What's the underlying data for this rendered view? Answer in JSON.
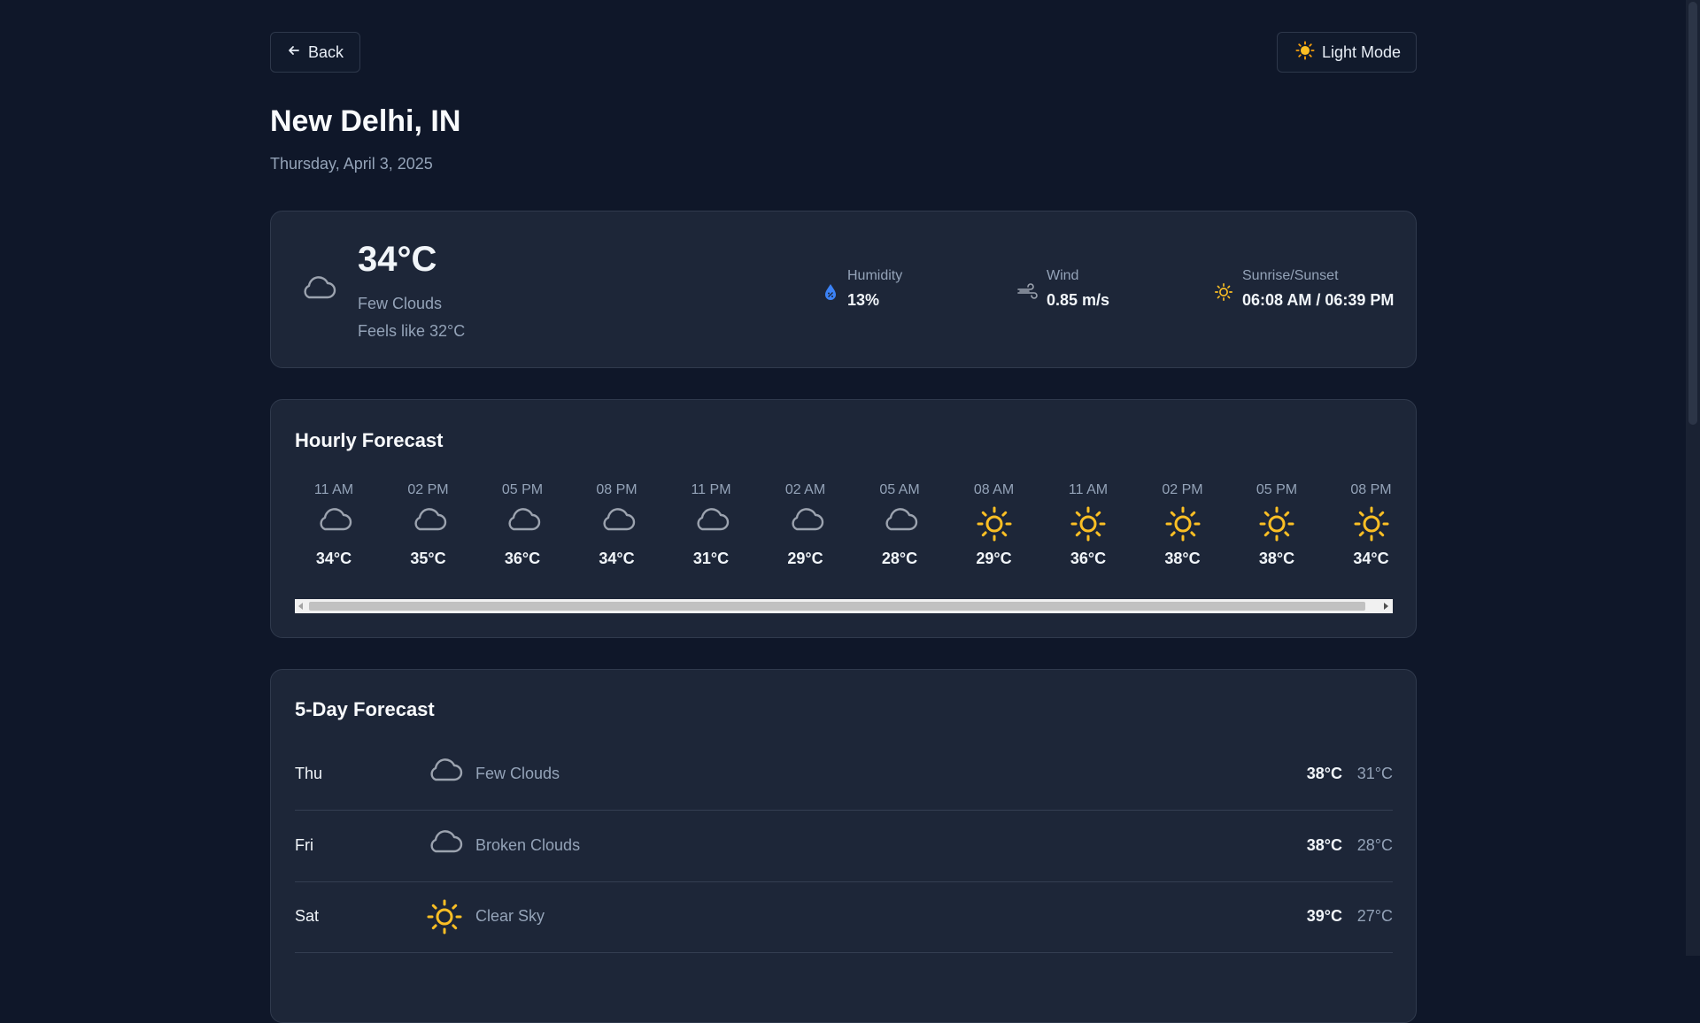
{
  "header": {
    "back_label": "Back",
    "mode_label": "Light Mode",
    "mode_icon": "sun-emoji"
  },
  "location": {
    "city": "New Delhi, IN",
    "date": "Thursday, April 3, 2025"
  },
  "current": {
    "temp": "34°C",
    "description": "Few Clouds",
    "feels_like": "Feels like 32°C",
    "icon": "cloud-icon",
    "humidity_label": "Humidity",
    "humidity_value": "13%",
    "wind_label": "Wind",
    "wind_value": "0.85 m/s",
    "sun_label": "Sunrise/Sunset",
    "sun_value": "06:08 AM / 06:39 PM"
  },
  "hourly": {
    "title": "Hourly Forecast",
    "items": [
      {
        "time": "11 AM",
        "icon": "cloud",
        "temp": "34°C"
      },
      {
        "time": "02 PM",
        "icon": "cloud",
        "temp": "35°C"
      },
      {
        "time": "05 PM",
        "icon": "cloud",
        "temp": "36°C"
      },
      {
        "time": "08 PM",
        "icon": "cloud",
        "temp": "34°C"
      },
      {
        "time": "11 PM",
        "icon": "cloud",
        "temp": "31°C"
      },
      {
        "time": "02 AM",
        "icon": "cloud",
        "temp": "29°C"
      },
      {
        "time": "05 AM",
        "icon": "cloud",
        "temp": "28°C"
      },
      {
        "time": "08 AM",
        "icon": "sun",
        "temp": "29°C"
      },
      {
        "time": "11 AM",
        "icon": "sun",
        "temp": "36°C"
      },
      {
        "time": "02 PM",
        "icon": "sun",
        "temp": "38°C"
      },
      {
        "time": "05 PM",
        "icon": "sun",
        "temp": "38°C"
      },
      {
        "time": "08 PM",
        "icon": "sun",
        "temp": "34°C"
      }
    ]
  },
  "daily": {
    "title": "5-Day Forecast",
    "items": [
      {
        "day": "Thu",
        "icon": "cloud",
        "description": "Few Clouds",
        "high": "38°C",
        "low": "31°C"
      },
      {
        "day": "Fri",
        "icon": "cloud",
        "description": "Broken Clouds",
        "high": "38°C",
        "low": "28°C"
      },
      {
        "day": "Sat",
        "icon": "sun",
        "description": "Clear Sky",
        "high": "39°C",
        "low": "27°C"
      }
    ]
  },
  "colors": {
    "background": "#0f1729",
    "card": "#1d2638",
    "sun": "#fbbf24",
    "cloud": "#9ca3af",
    "humidity": "#3b82f6"
  }
}
